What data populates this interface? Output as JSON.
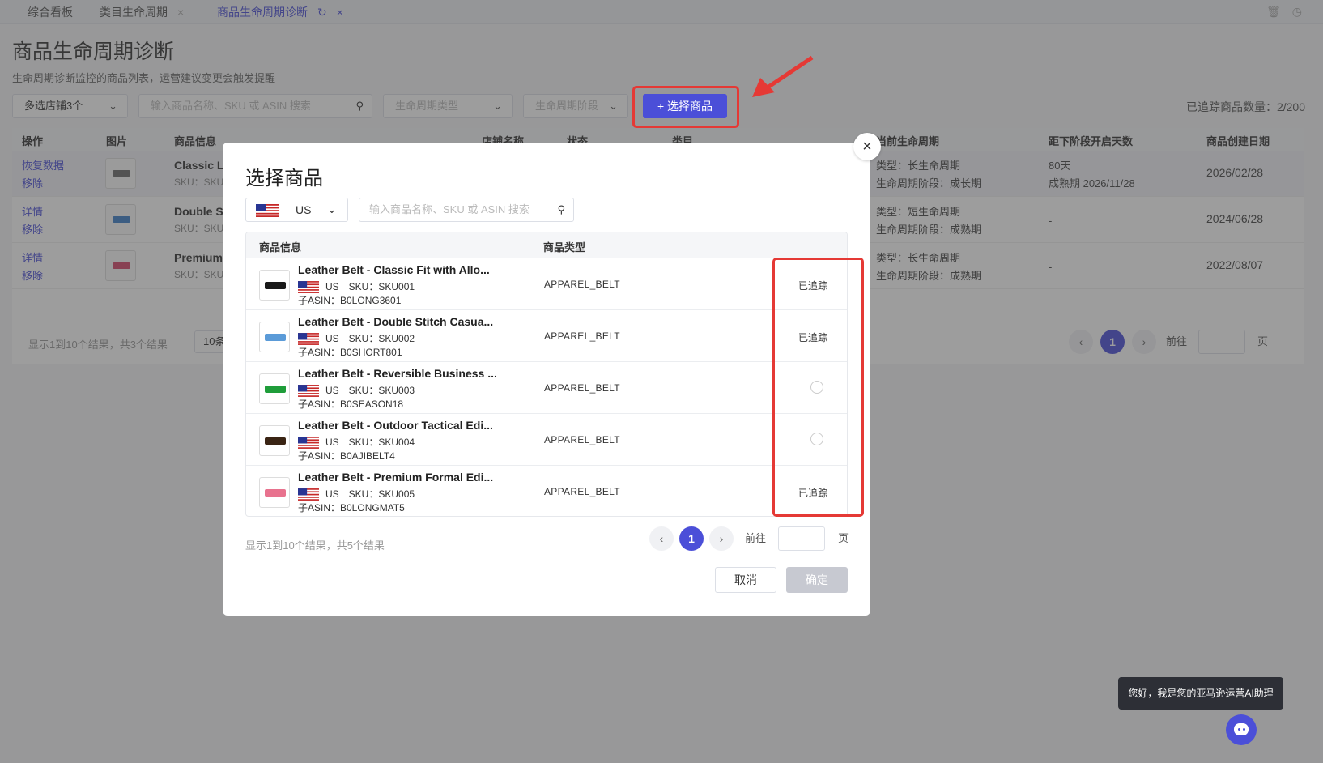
{
  "tabs": [
    {
      "label": "综合看板"
    },
    {
      "label": "类目生命周期",
      "close": "×"
    },
    {
      "label": "商品生命周期诊断",
      "refresh": "↻",
      "close": "×"
    }
  ],
  "page": {
    "title": "商品生命周期诊断",
    "subtitle": "生命周期诊断监控的商品列表，运营建议变更会触发提醒",
    "store_select": "多选店铺3个",
    "search_placeholder": "输入商品名称、SKU 或 ASIN 搜索",
    "cycle_type_placeholder": "生命周期类型",
    "cycle_stage_placeholder": "生命周期阶段",
    "select_button": "+ 选择商品",
    "tracked_count_label": "已追踪商品数量：",
    "tracked_count_value": "2/200"
  },
  "bg_table": {
    "headers": [
      "操作",
      "图片",
      "商品信息",
      "店铺名称",
      "状态",
      "类目",
      "当前生命周期",
      "距下阶段开启天数",
      "商品创建日期"
    ],
    "rows": [
      {
        "actions": [
          "恢复数据",
          "移除"
        ],
        "name": "Classic L",
        "sku": "SKU：SKU",
        "cycle_type": "类型：长生命周期",
        "cycle_stage": "生命周期阶段：成长期",
        "days": "80天",
        "days_sub": "成熟期 2026/11/28",
        "date": "2026/02/28",
        "color": "#6b6b6b"
      },
      {
        "actions": [
          "详情",
          "移除"
        ],
        "name": "Double S",
        "sku": "SKU：SKU",
        "cycle_type": "类型：短生命周期",
        "cycle_stage": "生命周期阶段：成熟期",
        "days": "-",
        "days_sub": "",
        "date": "2024/06/28",
        "color": "#3d7ec9"
      },
      {
        "actions": [
          "详情",
          "移除"
        ],
        "name": "Premium",
        "sku": "SKU：SKU",
        "cycle_type": "类型：长生命周期",
        "cycle_stage": "生命周期阶段：成熟期",
        "days": "-",
        "days_sub": "",
        "date": "2022/08/07",
        "color": "#d5466a"
      }
    ],
    "footer": "显示1到10个结果，共3个结果",
    "page_size": "10条",
    "current_page": "1",
    "goto_label": "前往",
    "page_unit": "页"
  },
  "modal": {
    "title": "选择商品",
    "country": "US",
    "search_placeholder": "输入商品名称、SKU 或 ASIN 搜索",
    "col_info": "商品信息",
    "col_type": "商品类型",
    "products": [
      {
        "name": "Leather Belt - Classic Fit with Allo...",
        "country": "US",
        "sku": "SKU：SKU001",
        "asin": "子ASIN：B0LONG3601",
        "type": "APPAREL_BELT",
        "status": "已追踪",
        "tracked": true,
        "color": "#1a1a1a"
      },
      {
        "name": "Leather Belt - Double Stitch Casua...",
        "country": "US",
        "sku": "SKU：SKU002",
        "asin": "子ASIN：B0SHORT801",
        "type": "APPAREL_BELT",
        "status": "已追踪",
        "tracked": true,
        "color": "#5b9bd8"
      },
      {
        "name": "Leather Belt - Reversible Business ...",
        "country": "US",
        "sku": "SKU：SKU003",
        "asin": "子ASIN：B0SEASON18",
        "type": "APPAREL_BELT",
        "status": "",
        "tracked": false,
        "color": "#1f9d3a"
      },
      {
        "name": "Leather Belt - Outdoor Tactical Edi...",
        "country": "US",
        "sku": "SKU：SKU004",
        "asin": "子ASIN：B0AJIBELT4",
        "type": "APPAREL_BELT",
        "status": "",
        "tracked": false,
        "color": "#3a2414"
      },
      {
        "name": "Leather Belt - Premium Formal Edi...",
        "country": "US",
        "sku": "SKU：SKU005",
        "asin": "子ASIN：B0LONGMAT5",
        "type": "APPAREL_BELT",
        "status": "已追踪",
        "tracked": true,
        "color": "#e8728e"
      }
    ],
    "footer": "显示1到10个结果，共5个结果",
    "current_page": "1",
    "goto_label": "前往",
    "page_unit": "页",
    "cancel": "取消",
    "confirm": "确定",
    "close": "×"
  },
  "ai": {
    "tooltip": "您好，我是您的亚马逊运营AI助理"
  },
  "colors": {
    "accent": "#4b4fd8",
    "highlight": "#e53935"
  }
}
